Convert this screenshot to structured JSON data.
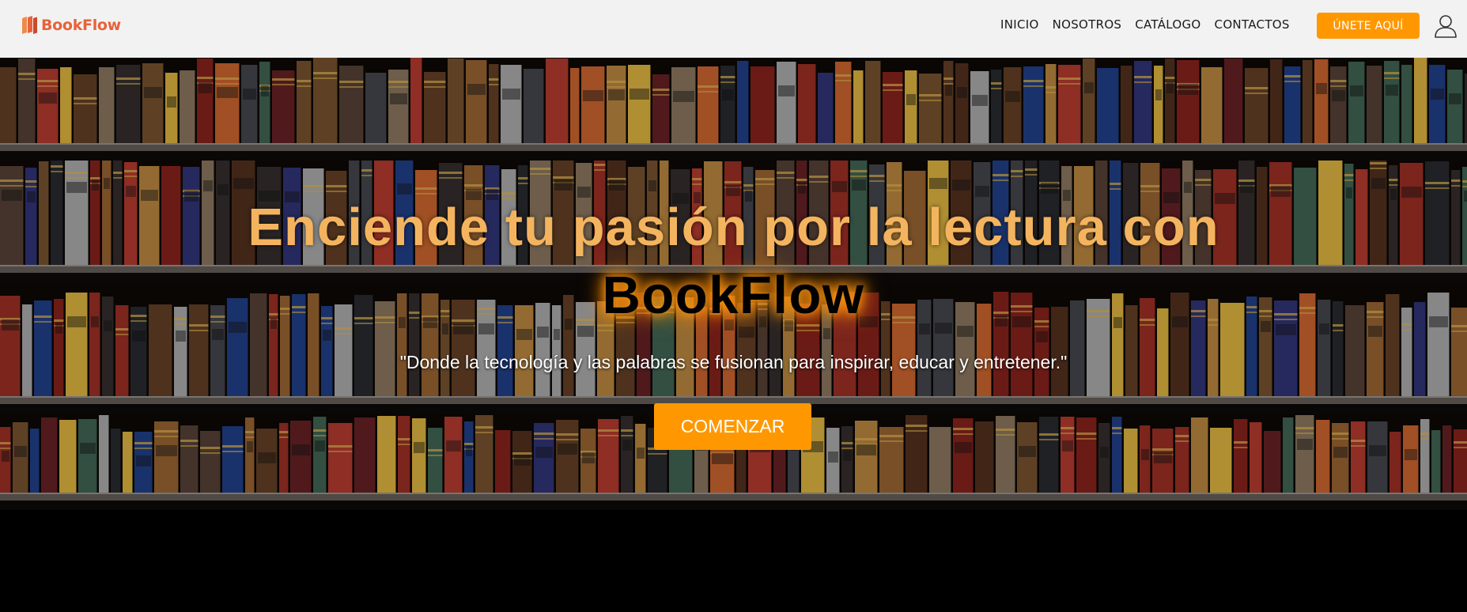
{
  "header": {
    "brand": "BookFlow",
    "nav": [
      {
        "label": "INICIO"
      },
      {
        "label": "NOSOTROS"
      },
      {
        "label": "CATÁLOGO"
      },
      {
        "label": "CONTACTOS"
      }
    ],
    "join_label": "ÚNETE AQUÍ",
    "user_icon": "user-icon"
  },
  "hero": {
    "title_line1": "Enciende tu pasión por la lectura con",
    "title_line2": "BookFlow",
    "tagline": "\"Donde la tecnología y las palabras se fusionan para inspirar, educar y entretener.\"",
    "cta_label": "COMENZAR",
    "background": "bookshelf"
  },
  "colors": {
    "accent": "#ff9800",
    "brand": "#e8623a",
    "title": "#f4b45f",
    "navbar_bg": "#f2f2f2"
  }
}
